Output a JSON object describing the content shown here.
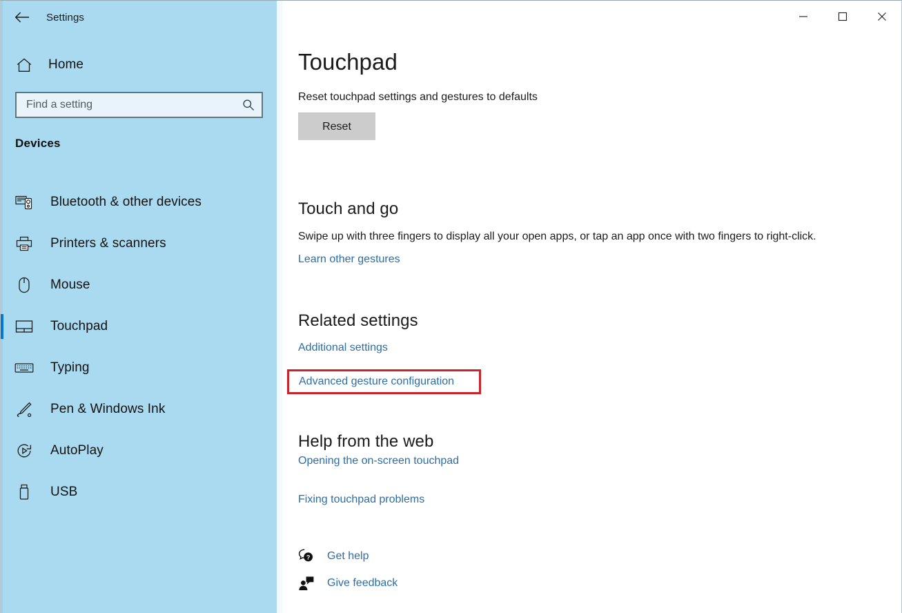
{
  "window": {
    "app_title": "Settings",
    "back_icon": "back-arrow-icon",
    "controls": {
      "minimize_label": "Minimize",
      "maximize_label": "Maximize",
      "close_label": "Close"
    }
  },
  "sidebar": {
    "home": {
      "label": "Home",
      "icon": "home-icon"
    },
    "search": {
      "placeholder": "Find a setting",
      "value": "",
      "icon": "search-icon"
    },
    "section_label": "Devices",
    "items": [
      {
        "label": "Bluetooth & other devices",
        "icon": "bluetooth-devices-icon",
        "selected": false
      },
      {
        "label": "Printers & scanners",
        "icon": "printer-icon",
        "selected": false
      },
      {
        "label": "Mouse",
        "icon": "mouse-icon",
        "selected": false
      },
      {
        "label": "Touchpad",
        "icon": "touchpad-icon",
        "selected": true
      },
      {
        "label": "Typing",
        "icon": "keyboard-icon",
        "selected": false
      },
      {
        "label": "Pen & Windows Ink",
        "icon": "pen-icon",
        "selected": false
      },
      {
        "label": "AutoPlay",
        "icon": "autoplay-icon",
        "selected": false
      },
      {
        "label": "USB",
        "icon": "usb-icon",
        "selected": false
      }
    ],
    "accent_color": "#0078d4",
    "background_color": "#a9daf0"
  },
  "main": {
    "page_title": "Touchpad",
    "reset": {
      "description": "Reset touchpad settings and gestures to defaults",
      "button_label": "Reset"
    },
    "touch_and_go": {
      "heading": "Touch and go",
      "description": "Swipe up with three fingers to display all your open apps, or tap an app once with two fingers to right-click.",
      "link": "Learn other gestures"
    },
    "related_settings": {
      "heading": "Related settings",
      "links": [
        "Additional settings",
        "Advanced gesture configuration"
      ],
      "highlighted_link": "Advanced gesture configuration",
      "highlight_color": "#cc2229"
    },
    "help_from_web": {
      "heading": "Help from the web",
      "links": [
        "Opening the on-screen touchpad",
        "Fixing touchpad problems"
      ]
    },
    "footer": [
      {
        "label": "Get help",
        "icon": "get-help-icon"
      },
      {
        "label": "Give feedback",
        "icon": "give-feedback-icon"
      }
    ],
    "link_color": "#2e6da4"
  }
}
